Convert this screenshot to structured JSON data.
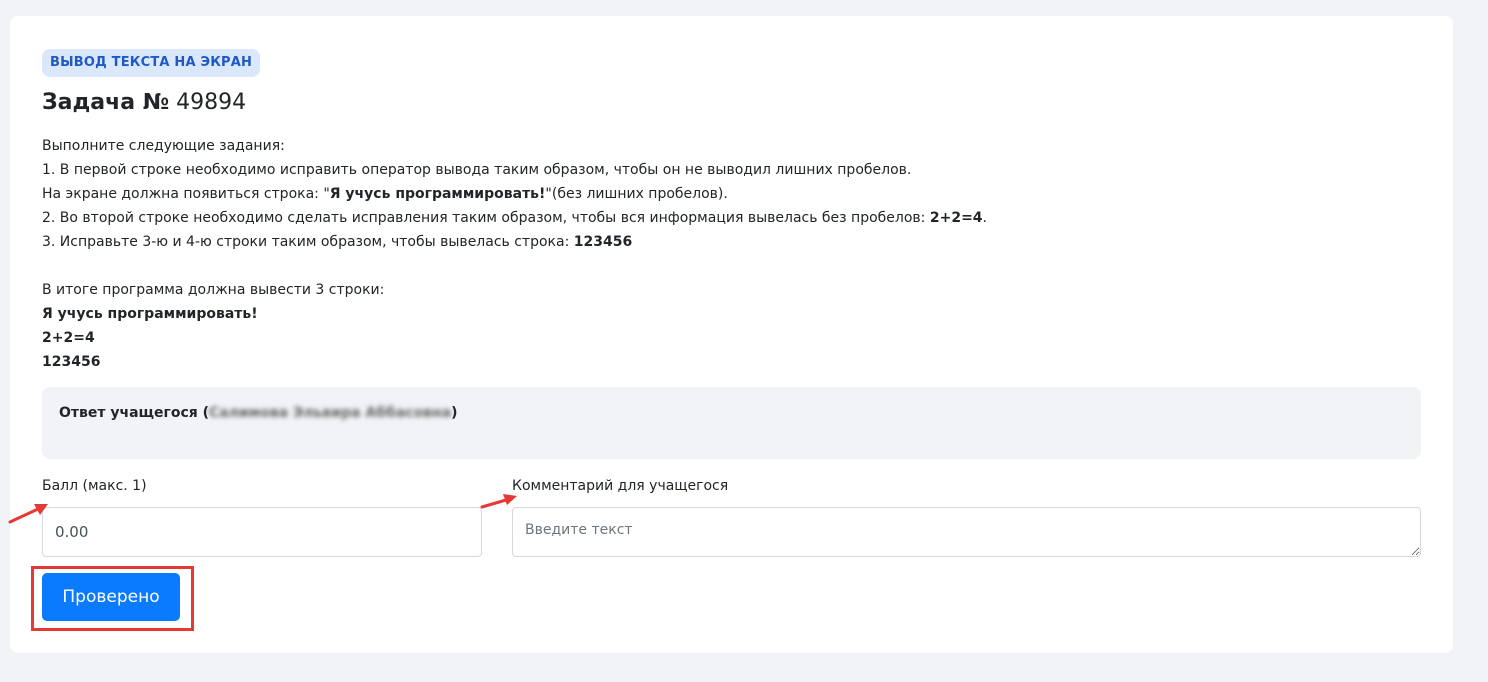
{
  "task": {
    "badge": "ВЫВОД ТЕКСТА НА ЭКРАН",
    "title_prefix": "Задача №",
    "title_number": " 49894",
    "description": {
      "l1": "Выполните следующие задания:",
      "l2": "1. В первой строке необходимо исправить оператор вывода таким образом, чтобы он не выводил лишних пробелов.",
      "l3_a": "На экране должна появиться строка: \"",
      "l3_b": "Я учусь программировать!",
      "l3_c": "\"(без лишних пробелов).",
      "l4_a": "2. Во второй строке необходимо сделать исправления таким образом, чтобы вся информация вывелась без пробелов: ",
      "l4_b": "2+2=4",
      "l4_c": ".",
      "l5_a": "3. Исправьте 3-ю и 4-ю строки таким образом, чтобы вывелась строка: ",
      "l5_b": "123456",
      "l6": "В итоге программа должна вывести 3 строки:",
      "out1": "Я учусь программировать!",
      "out2": "2+2=4",
      "out3": "123456"
    }
  },
  "answer": {
    "label_prefix": "Ответ учащегося (",
    "student_name": "Салимова Эльвира Аббасовна",
    "label_suffix": ")"
  },
  "grading": {
    "score_label": "Балл (макс. 1)",
    "score_value": "0.00",
    "comment_label": "Комментарий для учащегося",
    "comment_placeholder": "Введите текст",
    "submit_label": "Проверено"
  },
  "colors": {
    "accent": "#0a7bff",
    "annotation": "#e53935",
    "badge_bg": "#dbe7fb",
    "badge_text": "#1f59c4"
  }
}
